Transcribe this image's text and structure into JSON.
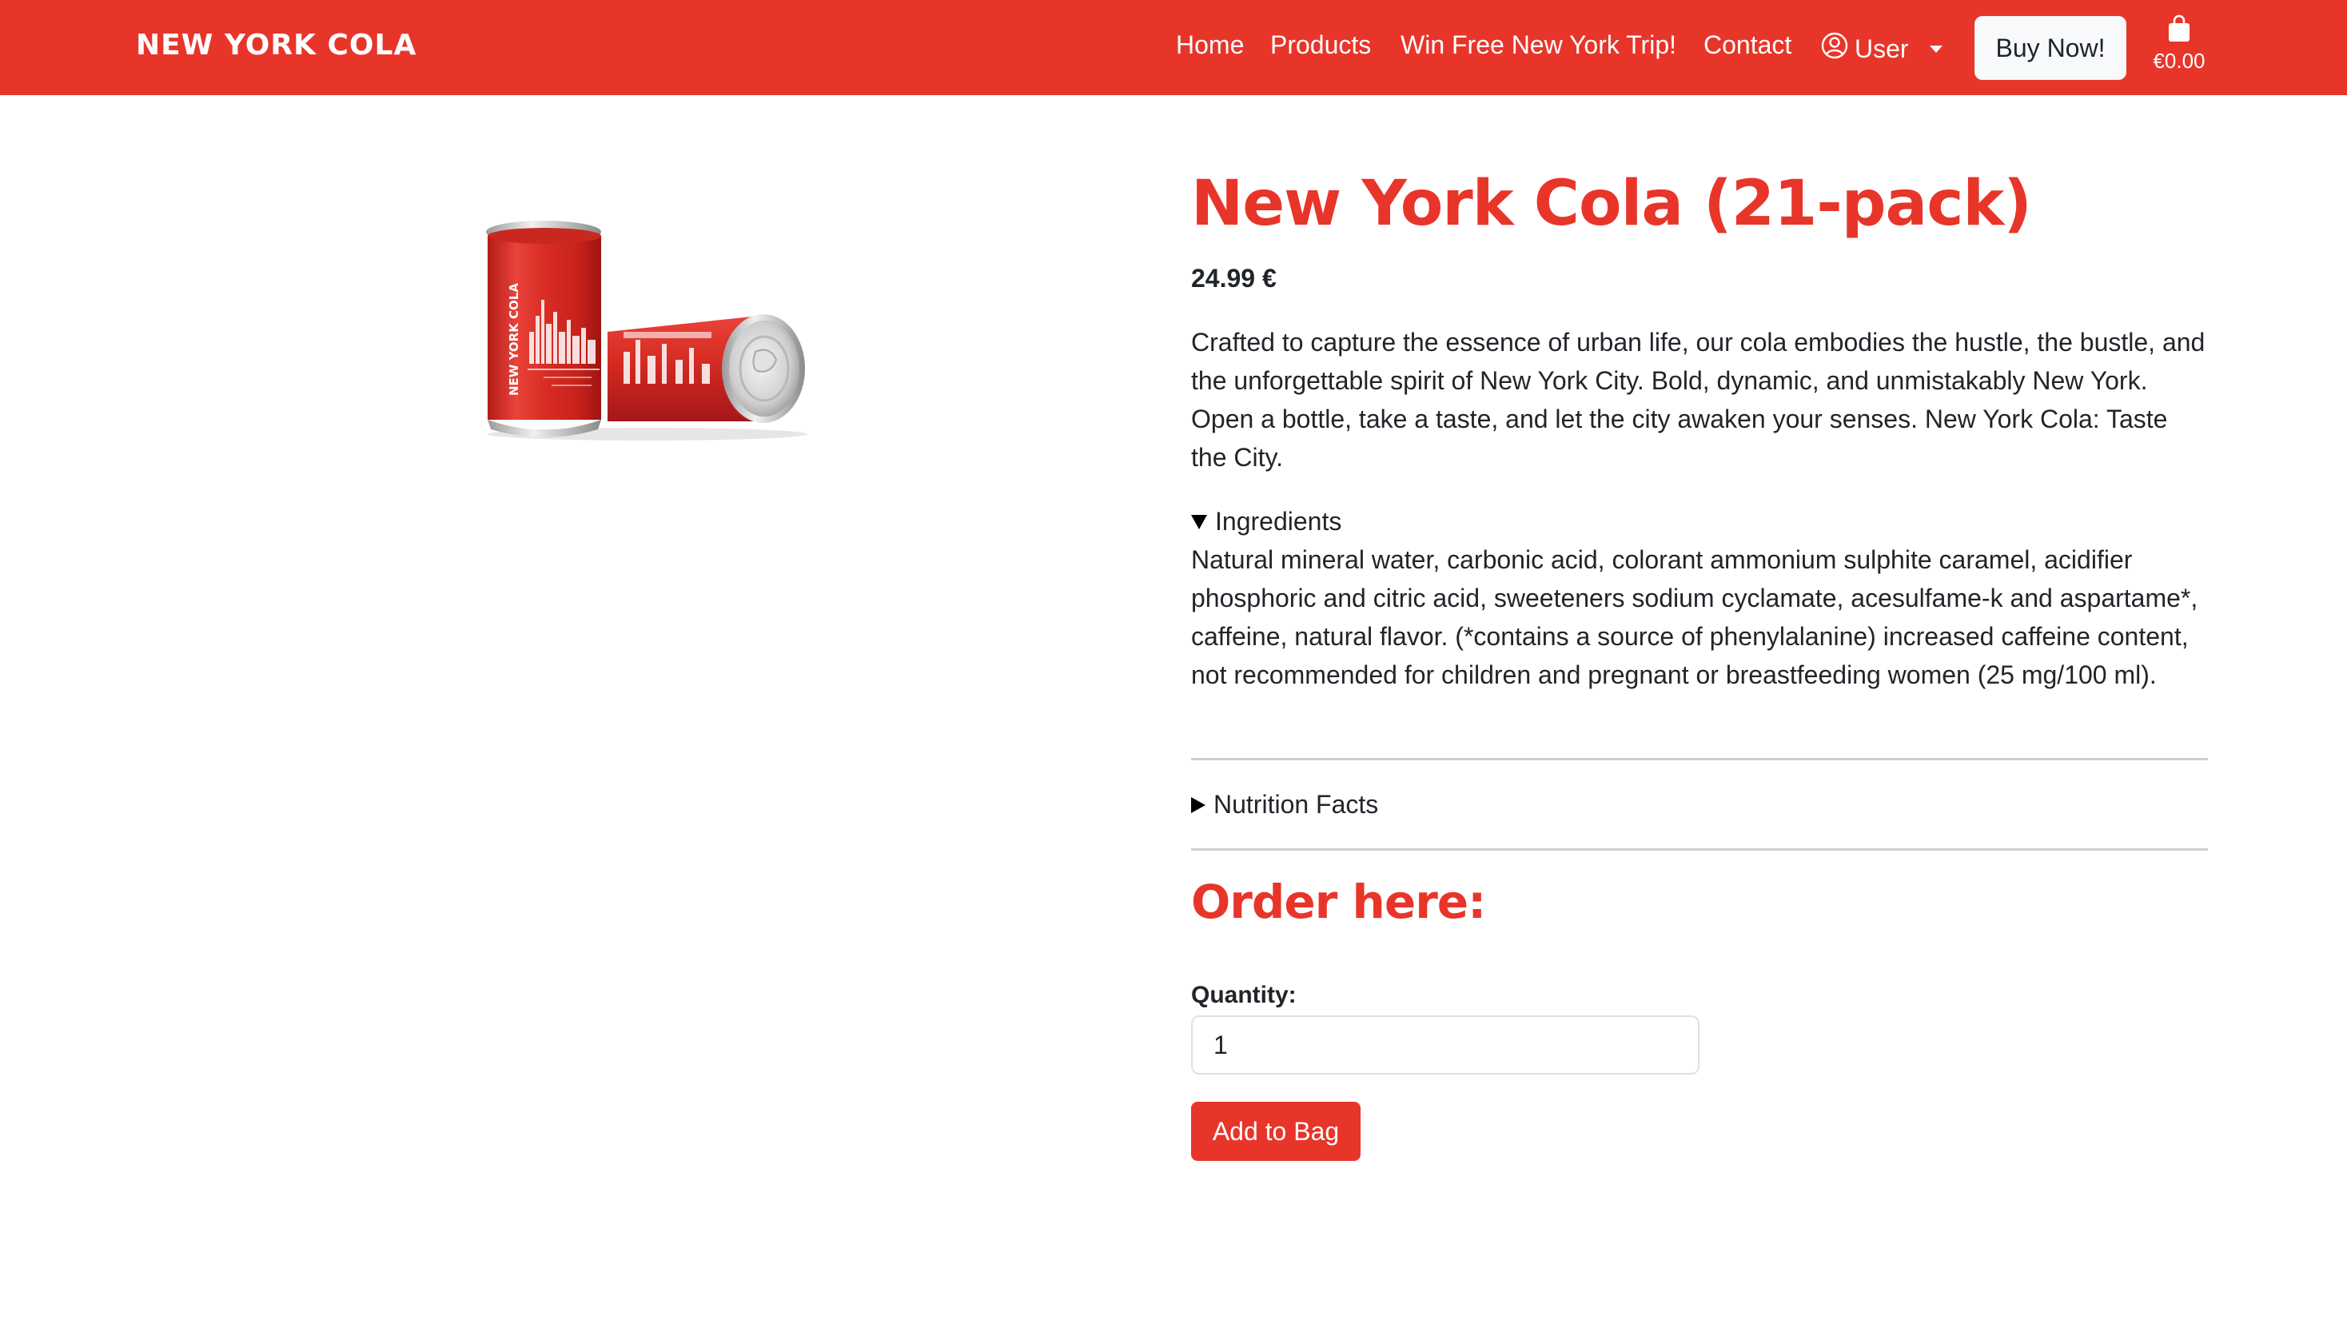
{
  "navbar": {
    "brand": "NEW YORK COLA",
    "links": [
      "Home",
      "Products",
      "Win Free New York Trip!",
      "Contact"
    ],
    "user_label": "User",
    "buy_now_label": "Buy Now!",
    "bag_total": "€0.00",
    "background_color": "#e8352a"
  },
  "product": {
    "title": "New York Cola (21-pack)",
    "price": "24.99 €",
    "description": "Crafted to capture the essence of urban life, our cola embodies the hustle, the bustle, and the unforgettable spirit of New York City. Bold, dynamic, and unmistakably New York. Open a bottle, take a taste, and let the city awaken your senses. New York Cola: Taste the City.",
    "ingredients_label": "Ingredients",
    "ingredients_text": "Natural mineral water, carbonic acid, colorant ammonium sulphite caramel, acidifier phosphoric and citric acid, sweeteners sodium cyclamate, acesulfame-k and aspartame*, caffeine, natural flavor. (*contains a source of phenylalanine) increased caffeine content, not recommended for children and pregnant or breastfeeding women (25 mg/100 ml).",
    "nutrition_label": "Nutrition Facts",
    "can_text": "NEW YORK COLA"
  },
  "order": {
    "heading": "Order here:",
    "quantity_label": "Quantity:",
    "quantity_value": "1",
    "add_to_bag_label": "Add to Bag"
  },
  "icons": {
    "user": "user-circle-icon",
    "bag": "shopping-bag-icon",
    "caret": "caret-down-icon"
  }
}
